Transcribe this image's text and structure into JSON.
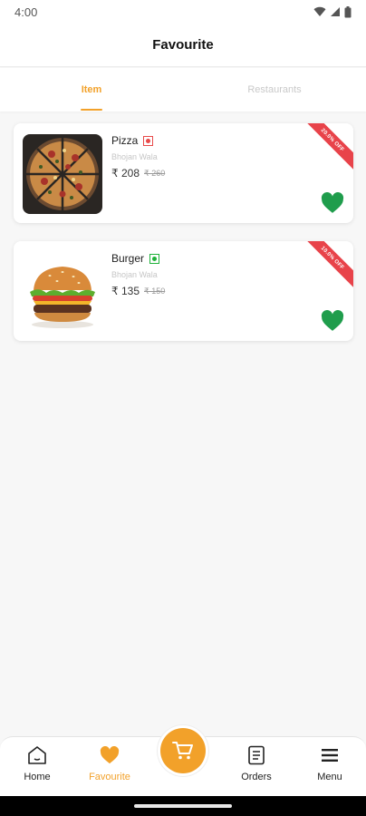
{
  "status_bar": {
    "time": "4:00"
  },
  "header": {
    "title": "Favourite"
  },
  "tabs": [
    {
      "label": "Item",
      "active": true
    },
    {
      "label": "Restaurants",
      "active": false
    }
  ],
  "items": [
    {
      "name": "Pizza",
      "veg": false,
      "restaurant": "Bhojan Wala",
      "price": "₹ 208",
      "old_price": "₹ 260",
      "discount": "20.0% OFF",
      "favourited": true
    },
    {
      "name": "Burger",
      "veg": true,
      "restaurant": "Bhojan Wala",
      "price": "₹ 135",
      "old_price": "₹ 150",
      "discount": "10.0% OFF",
      "favourited": true
    }
  ],
  "bottom_nav": {
    "items": [
      {
        "label": "Home",
        "icon": "home-icon"
      },
      {
        "label": "Favourite",
        "icon": "heart-icon",
        "active": true
      },
      {
        "label": "Orders",
        "icon": "orders-icon"
      },
      {
        "label": "Menu",
        "icon": "menu-icon"
      }
    ],
    "cart_icon": "cart-icon"
  },
  "colors": {
    "accent": "#f2a12a",
    "heart": "#1f9d4c",
    "discount": "#e8434a",
    "veg": "#1fb23a",
    "non_veg": "#e84a4a"
  }
}
